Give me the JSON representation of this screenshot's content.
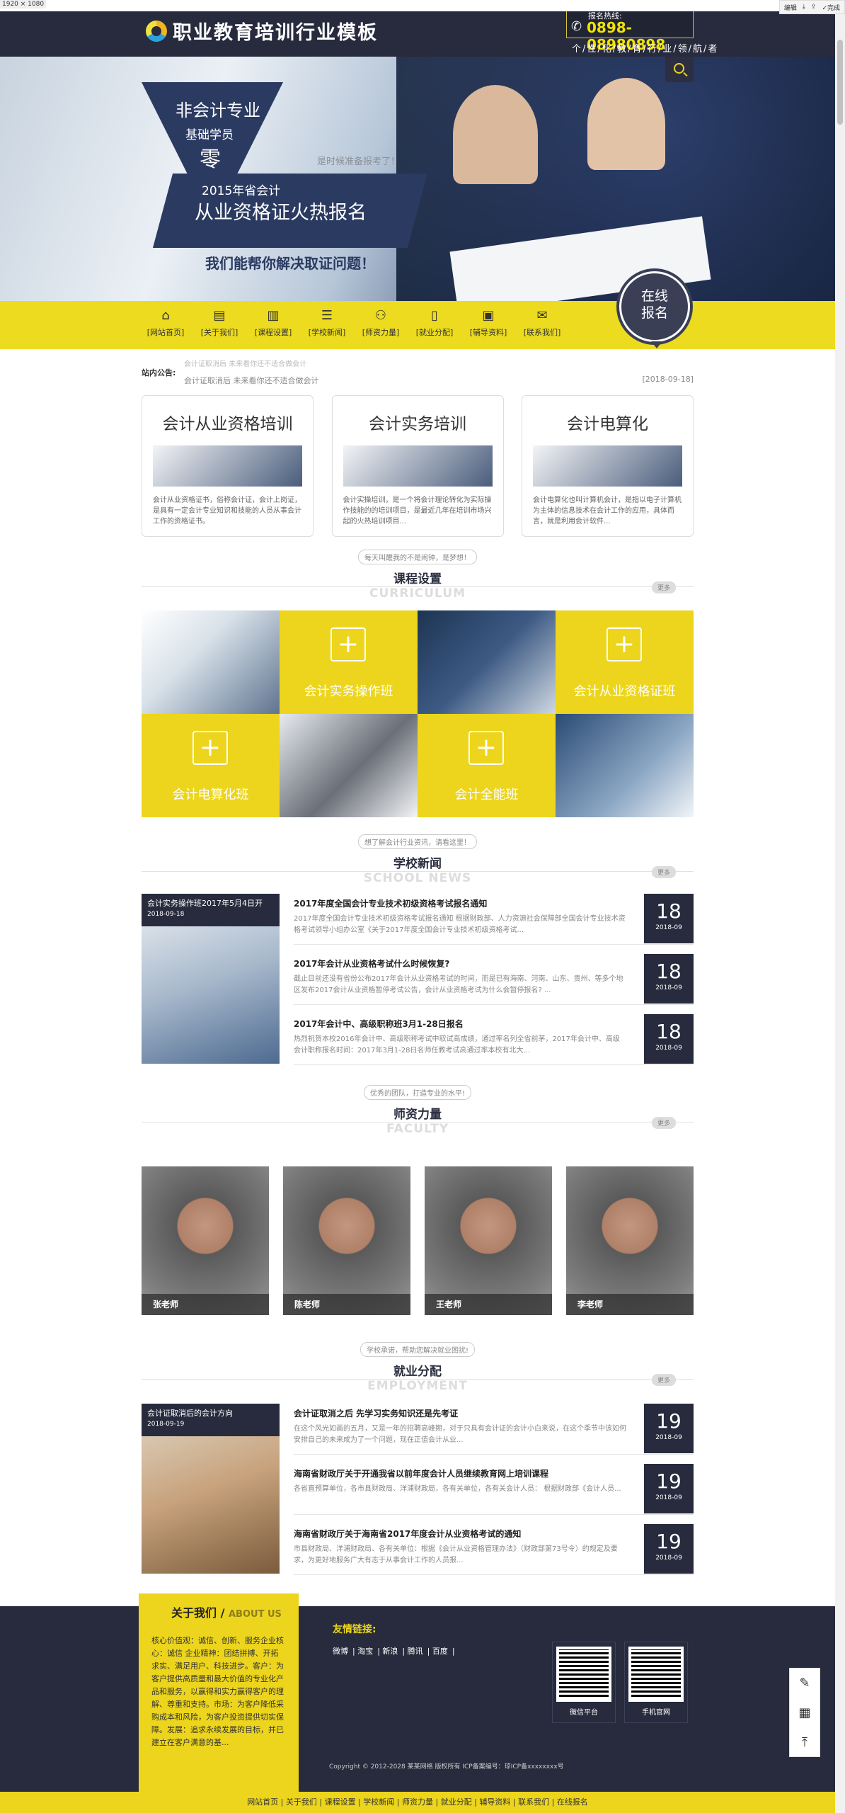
{
  "window": {
    "dims": "1920 × 1080",
    "tools": [
      "编辑",
      "",
      "",
      "完成"
    ]
  },
  "header": {
    "logo": "职业教育培训行业模板",
    "hotline_label": "报名热线:",
    "hotline": "0898-08980898",
    "slogan": "个/性/化/教/育/行/业/领/航/者"
  },
  "banner": {
    "t1": "非会计专业",
    "t2": "基础学员",
    "t3": "零",
    "rib1": "2015年省会计",
    "rib2": "从业资格证火热报名",
    "ready": "是时候准备报考了！",
    "help": "我们能帮你解决取证问题！"
  },
  "nav": {
    "items": [
      "[网站首页]",
      "[关于我们]",
      "[课程设置]",
      "[学校新闻]",
      "[师资力量]",
      "[就业分配]",
      "[辅导资料]",
      "[联系我们]"
    ],
    "icons": [
      "home-icon",
      "doc-icon",
      "book-icon",
      "news-icon",
      "people-icon",
      "phone-icon",
      "id-card-icon",
      "mail-icon"
    ],
    "online": "在线报名"
  },
  "notice": {
    "label": "站内公告:",
    "text": "会计证取消后 未来看你还不适合做会计",
    "date": "[2018-09-18]"
  },
  "cards": [
    {
      "title": "会计从业资格培训",
      "desc": "会计从业资格证书，俗称会计证，会计上岗证，是具有一定会计专业知识和技能的人员从事会计工作的资格证书。"
    },
    {
      "title": "会计实务培训",
      "desc": "会计实操培训，是一个将会计理论转化为实际操作技能的的培训项目，是最近几年在培训市场兴起的火热培训项目..."
    },
    {
      "title": "会计电算化",
      "desc": "会计电算化也叫计算机会计，是指以电子计算机为主体的信息技术在会计工作的应用，具体而言，就是利用会计软件..."
    }
  ],
  "curriculum": {
    "pill": "每天叫醒我的不是闹钟，是梦想！",
    "cn": "课程设置",
    "en": "CURRICULUM",
    "more": "更多",
    "tiles": [
      "会计实务操作班",
      "会计从业资格证班",
      "会计电算化班",
      "会计全能班"
    ]
  },
  "news": {
    "pill": "想了解会计行业资讯，请看这里！",
    "cn": "学校新闻",
    "en": "SCHOOL NEWS",
    "more": "更多",
    "feature": {
      "title": "会计实务操作班2017年5月4日开",
      "date": "2018-09-18"
    },
    "items": [
      {
        "title": "2017年度全国会计专业技术初级资格考试报名通知",
        "desc": "2017年度全国会计专业技术初级资格考试报名通知    根据财政部、人力资源社会保障部全国会计专业技术资格考试领导小组办公室《关于2017年度全国会计专业技术初级资格考试...",
        "day": "18",
        "ym": "2018-09"
      },
      {
        "title": "2017年会计从业资格考试什么时候恢复?",
        "desc": "截止目前还没有省份公布2017年会计从业资格考试的时间，而是已有海南、河南、山东、贵州、等多个地区发布2017会计从业资格暂停考试公告，会计从业资格考试为什么会暂停报名?    ...",
        "day": "18",
        "ym": "2018-09"
      },
      {
        "title": "2017年会计中、高级职称班3月1-28日报名",
        "desc": "热烈祝贺本校2016年会计中、高级职称考试中取试高成绩，通过率名列全省前茅，2017年会计中、高级会计职称报名时间：2017年3月1-28日名师任教考试高通过率本校有北大...",
        "day": "18",
        "ym": "2018-09"
      }
    ]
  },
  "faculty": {
    "pill": "优秀的团队，打造专业的水平!",
    "cn": "师资力量",
    "en": "FACULTY",
    "more": "更多",
    "teachers": [
      "张老师",
      "陈老师",
      "王老师",
      "李老师"
    ]
  },
  "employment": {
    "pill": "学校承诺，帮助您解决就业困扰!",
    "cn": "就业分配",
    "en": "EMPLOYMENT",
    "more": "更多",
    "feature": {
      "title": "会计证取消后的会计方向",
      "date": "2018-09-19"
    },
    "items": [
      {
        "title": "会计证取消之后 先学习实务知识还是先考证",
        "desc": "在这个风光如画的五月，又是一年的招聘高峰期，对于只具有会计证的会计小白来说，在这个季节中该如何安排自己的未来成为了一个问题，现在正值会计从业...",
        "day": "19",
        "ym": "2018-09"
      },
      {
        "title": "海南省财政厅关于开通我省以前年度会计人员继续教育网上培训课程",
        "desc": "各省直预算单位，各市县财政局、洋浦财政局，各有关单位，各有关会计人员：    根据财政部《会计人员...",
        "day": "19",
        "ym": "2018-09"
      },
      {
        "title": "海南省财政厅关于海南省2017年度会计从业资格考试的通知",
        "desc": "市县财政局、洋浦财政局、各有关单位：根据《会计从业资格管理办法》（财政部第73号令）的规定及要求，为更好地服务广大有志于从事会计工作的人员报...",
        "day": "19",
        "ym": "2018-09"
      }
    ]
  },
  "footer": {
    "about_title": "关于我们 /",
    "about_en": "ABOUT US",
    "about_text": "核心价值观：诚信、创新、服务企业核心：诚信 企业精神：团结拼搏、开拓求实、满足用户、科技进步。客户：为客户提供高质量和最大价值的专业化产品和服务，以赢得和实力赢得客户的理解、尊重和支持。市场：为客户降低采购成本和风险，为客户投资提供切实保障。发展：追求永续发展的目标，并已建立在客户满意的基...",
    "links_title": "友情链接:",
    "links": [
      "微博",
      "淘宝",
      "新浪",
      "腾讯",
      "百度"
    ],
    "qr1": "微信平台",
    "qr2": "手机官网",
    "copyright": "Copyright © 2012-2028 某某网络 版权所有    ICP备案编号：琼ICP备xxxxxxxx号"
  },
  "bottom_nav": [
    "网站首页",
    "关于我们",
    "课程设置",
    "学校新闻",
    "师资力量",
    "就业分配",
    "辅导资料",
    "联系我们",
    "在线报名"
  ]
}
